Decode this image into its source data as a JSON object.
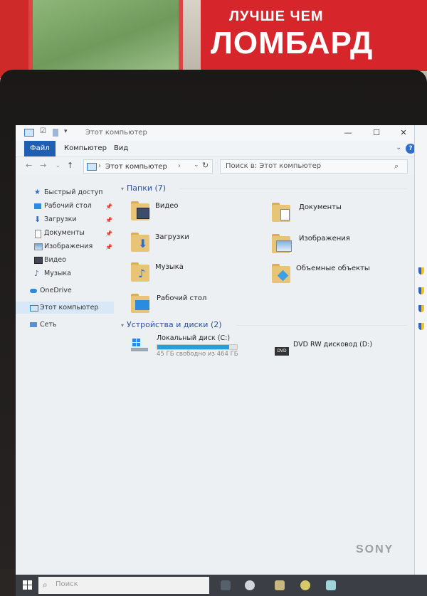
{
  "scene": {
    "sign_line1": "ЛУЧШЕ ЧЕМ",
    "sign_line2": "ЛОМБАРД",
    "brand": "SONY"
  },
  "window": {
    "title": "Этот компьютер",
    "controls": {
      "minimize": "—",
      "maximize": "☐",
      "close": "✕"
    }
  },
  "ribbon": {
    "tabs": [
      {
        "label": "Файл",
        "active": true
      },
      {
        "label": "Компьютер",
        "active": false
      },
      {
        "label": "Вид",
        "active": false
      }
    ],
    "help": "?"
  },
  "address": {
    "path_label": "Этот компьютер",
    "separator": "›",
    "search_placeholder": "Поиск в: Этот компьютер"
  },
  "nav": {
    "items": [
      {
        "label": "Быстрый доступ",
        "icon": "star-icon",
        "pinned": false
      },
      {
        "label": "Рабочий стол",
        "icon": "desktop-icon",
        "pinned": true
      },
      {
        "label": "Загрузки",
        "icon": "downloads-icon",
        "pinned": true
      },
      {
        "label": "Документы",
        "icon": "documents-icon",
        "pinned": true
      },
      {
        "label": "Изображения",
        "icon": "pictures-icon",
        "pinned": true
      },
      {
        "label": "Видео",
        "icon": "video-icon",
        "pinned": false
      },
      {
        "label": "Музыка",
        "icon": "music-icon",
        "pinned": false
      },
      {
        "label": "OneDrive",
        "icon": "cloud-icon",
        "pinned": false
      },
      {
        "label": "Этот компьютер",
        "icon": "computer-icon",
        "pinned": false,
        "selected": true
      },
      {
        "label": "Сеть",
        "icon": "network-icon",
        "pinned": false
      }
    ]
  },
  "folders": {
    "header": "Папки (7)",
    "items": [
      {
        "label": "Видео",
        "icon": "video-folder-icon"
      },
      {
        "label": "Документы",
        "icon": "documents-folder-icon"
      },
      {
        "label": "Загрузки",
        "icon": "downloads-folder-icon"
      },
      {
        "label": "Изображения",
        "icon": "pictures-folder-icon"
      },
      {
        "label": "Музыка",
        "icon": "music-folder-icon"
      },
      {
        "label": "Объемные объекты",
        "icon": "3d-objects-folder-icon"
      },
      {
        "label": "Рабочий стол",
        "icon": "desktop-folder-icon"
      }
    ]
  },
  "drives": {
    "header": "Устройства и диски (2)",
    "items": [
      {
        "label": "Локальный диск (C:)",
        "sub": "45 ГБ свободно из 464 ГБ",
        "used_fraction": 0.9,
        "icon": "windows-drive-icon"
      },
      {
        "label": "DVD RW дисковод (D:)",
        "icon": "dvd-drive-icon",
        "icon_text": "DVD"
      }
    ]
  },
  "taskbar": {
    "search_placeholder": "Поиск"
  },
  "colors": {
    "accent": "#1f5fb3",
    "folder": "#e8c477",
    "header_text": "#2b4f9c",
    "drive_fill": "#26a0da"
  }
}
